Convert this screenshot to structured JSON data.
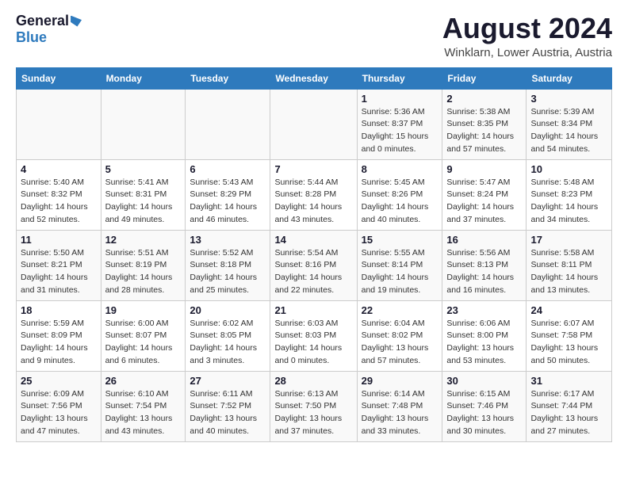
{
  "logo": {
    "general": "General",
    "blue": "Blue"
  },
  "title": "August 2024",
  "subtitle": "Winklarn, Lower Austria, Austria",
  "weekdays": [
    "Sunday",
    "Monday",
    "Tuesday",
    "Wednesday",
    "Thursday",
    "Friday",
    "Saturday"
  ],
  "weeks": [
    [
      {
        "day": "",
        "sunrise": "",
        "sunset": "",
        "daylight": ""
      },
      {
        "day": "",
        "sunrise": "",
        "sunset": "",
        "daylight": ""
      },
      {
        "day": "",
        "sunrise": "",
        "sunset": "",
        "daylight": ""
      },
      {
        "day": "",
        "sunrise": "",
        "sunset": "",
        "daylight": ""
      },
      {
        "day": "1",
        "sunrise": "Sunrise: 5:36 AM",
        "sunset": "Sunset: 8:37 PM",
        "daylight": "Daylight: 15 hours and 0 minutes."
      },
      {
        "day": "2",
        "sunrise": "Sunrise: 5:38 AM",
        "sunset": "Sunset: 8:35 PM",
        "daylight": "Daylight: 14 hours and 57 minutes."
      },
      {
        "day": "3",
        "sunrise": "Sunrise: 5:39 AM",
        "sunset": "Sunset: 8:34 PM",
        "daylight": "Daylight: 14 hours and 54 minutes."
      }
    ],
    [
      {
        "day": "4",
        "sunrise": "Sunrise: 5:40 AM",
        "sunset": "Sunset: 8:32 PM",
        "daylight": "Daylight: 14 hours and 52 minutes."
      },
      {
        "day": "5",
        "sunrise": "Sunrise: 5:41 AM",
        "sunset": "Sunset: 8:31 PM",
        "daylight": "Daylight: 14 hours and 49 minutes."
      },
      {
        "day": "6",
        "sunrise": "Sunrise: 5:43 AM",
        "sunset": "Sunset: 8:29 PM",
        "daylight": "Daylight: 14 hours and 46 minutes."
      },
      {
        "day": "7",
        "sunrise": "Sunrise: 5:44 AM",
        "sunset": "Sunset: 8:28 PM",
        "daylight": "Daylight: 14 hours and 43 minutes."
      },
      {
        "day": "8",
        "sunrise": "Sunrise: 5:45 AM",
        "sunset": "Sunset: 8:26 PM",
        "daylight": "Daylight: 14 hours and 40 minutes."
      },
      {
        "day": "9",
        "sunrise": "Sunrise: 5:47 AM",
        "sunset": "Sunset: 8:24 PM",
        "daylight": "Daylight: 14 hours and 37 minutes."
      },
      {
        "day": "10",
        "sunrise": "Sunrise: 5:48 AM",
        "sunset": "Sunset: 8:23 PM",
        "daylight": "Daylight: 14 hours and 34 minutes."
      }
    ],
    [
      {
        "day": "11",
        "sunrise": "Sunrise: 5:50 AM",
        "sunset": "Sunset: 8:21 PM",
        "daylight": "Daylight: 14 hours and 31 minutes."
      },
      {
        "day": "12",
        "sunrise": "Sunrise: 5:51 AM",
        "sunset": "Sunset: 8:19 PM",
        "daylight": "Daylight: 14 hours and 28 minutes."
      },
      {
        "day": "13",
        "sunrise": "Sunrise: 5:52 AM",
        "sunset": "Sunset: 8:18 PM",
        "daylight": "Daylight: 14 hours and 25 minutes."
      },
      {
        "day": "14",
        "sunrise": "Sunrise: 5:54 AM",
        "sunset": "Sunset: 8:16 PM",
        "daylight": "Daylight: 14 hours and 22 minutes."
      },
      {
        "day": "15",
        "sunrise": "Sunrise: 5:55 AM",
        "sunset": "Sunset: 8:14 PM",
        "daylight": "Daylight: 14 hours and 19 minutes."
      },
      {
        "day": "16",
        "sunrise": "Sunrise: 5:56 AM",
        "sunset": "Sunset: 8:13 PM",
        "daylight": "Daylight: 14 hours and 16 minutes."
      },
      {
        "day": "17",
        "sunrise": "Sunrise: 5:58 AM",
        "sunset": "Sunset: 8:11 PM",
        "daylight": "Daylight: 14 hours and 13 minutes."
      }
    ],
    [
      {
        "day": "18",
        "sunrise": "Sunrise: 5:59 AM",
        "sunset": "Sunset: 8:09 PM",
        "daylight": "Daylight: 14 hours and 9 minutes."
      },
      {
        "day": "19",
        "sunrise": "Sunrise: 6:00 AM",
        "sunset": "Sunset: 8:07 PM",
        "daylight": "Daylight: 14 hours and 6 minutes."
      },
      {
        "day": "20",
        "sunrise": "Sunrise: 6:02 AM",
        "sunset": "Sunset: 8:05 PM",
        "daylight": "Daylight: 14 hours and 3 minutes."
      },
      {
        "day": "21",
        "sunrise": "Sunrise: 6:03 AM",
        "sunset": "Sunset: 8:03 PM",
        "daylight": "Daylight: 14 hours and 0 minutes."
      },
      {
        "day": "22",
        "sunrise": "Sunrise: 6:04 AM",
        "sunset": "Sunset: 8:02 PM",
        "daylight": "Daylight: 13 hours and 57 minutes."
      },
      {
        "day": "23",
        "sunrise": "Sunrise: 6:06 AM",
        "sunset": "Sunset: 8:00 PM",
        "daylight": "Daylight: 13 hours and 53 minutes."
      },
      {
        "day": "24",
        "sunrise": "Sunrise: 6:07 AM",
        "sunset": "Sunset: 7:58 PM",
        "daylight": "Daylight: 13 hours and 50 minutes."
      }
    ],
    [
      {
        "day": "25",
        "sunrise": "Sunrise: 6:09 AM",
        "sunset": "Sunset: 7:56 PM",
        "daylight": "Daylight: 13 hours and 47 minutes."
      },
      {
        "day": "26",
        "sunrise": "Sunrise: 6:10 AM",
        "sunset": "Sunset: 7:54 PM",
        "daylight": "Daylight: 13 hours and 43 minutes."
      },
      {
        "day": "27",
        "sunrise": "Sunrise: 6:11 AM",
        "sunset": "Sunset: 7:52 PM",
        "daylight": "Daylight: 13 hours and 40 minutes."
      },
      {
        "day": "28",
        "sunrise": "Sunrise: 6:13 AM",
        "sunset": "Sunset: 7:50 PM",
        "daylight": "Daylight: 13 hours and 37 minutes."
      },
      {
        "day": "29",
        "sunrise": "Sunrise: 6:14 AM",
        "sunset": "Sunset: 7:48 PM",
        "daylight": "Daylight: 13 hours and 33 minutes."
      },
      {
        "day": "30",
        "sunrise": "Sunrise: 6:15 AM",
        "sunset": "Sunset: 7:46 PM",
        "daylight": "Daylight: 13 hours and 30 minutes."
      },
      {
        "day": "31",
        "sunrise": "Sunrise: 6:17 AM",
        "sunset": "Sunset: 7:44 PM",
        "daylight": "Daylight: 13 hours and 27 minutes."
      }
    ]
  ]
}
